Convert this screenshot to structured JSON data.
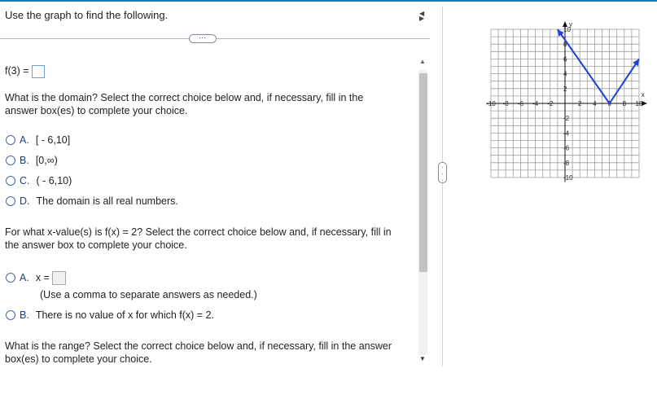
{
  "header": {
    "title": "Use the graph to find the following.",
    "ellipsis": "⋯"
  },
  "q1": {
    "label": "f(3) ="
  },
  "q2": {
    "prompt_line1": "What is the domain? Select the correct choice below and, if necessary, fill in the",
    "prompt_line2": "answer box(es) to complete your choice.",
    "choices": [
      {
        "letter": "A.",
        "text": "[ - 6,10]"
      },
      {
        "letter": "B.",
        "text": "[0,∞)"
      },
      {
        "letter": "C.",
        "text": "( - 6,10)"
      },
      {
        "letter": "D.",
        "text": "The domain is all real numbers."
      }
    ]
  },
  "q3": {
    "prompt_line1": "For what x-value(s) is f(x) = 2? Select the correct choice below and, if necessary, fill in",
    "prompt_line2": "the answer box to complete your choice.",
    "choice_a_letter": "A.",
    "choice_a_label": "x =",
    "choice_a_hint": "(Use a comma to separate answers as needed.)",
    "choice_b_letter": "B.",
    "choice_b_text": "There is no value of x for which f(x) = 2."
  },
  "q4": {
    "prompt_line1": "What is the range? Select the correct choice below and, if necessary, fill in the answer",
    "prompt_line2": "box(es) to complete your choice."
  },
  "graph": {
    "y_axis_label": "y",
    "x_axis_label": "x",
    "x_ticks": [
      "-10",
      "-8",
      "-6",
      "-4",
      "-2",
      "2",
      "4",
      "6",
      "8",
      "10"
    ],
    "y_ticks": [
      "10",
      "8",
      "6",
      "4",
      "2",
      "-2",
      "-4",
      "-6",
      "-8",
      "-10"
    ],
    "curve_color": "#1f3fd6",
    "points": [
      [
        -1,
        10
      ],
      [
        6,
        0
      ],
      [
        10,
        6
      ]
    ]
  }
}
